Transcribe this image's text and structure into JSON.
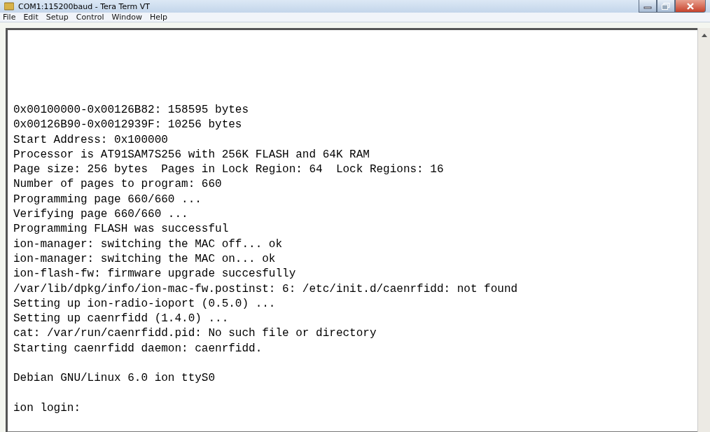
{
  "window": {
    "title": "COM1:115200baud - Tera Term VT"
  },
  "menu": [
    "File",
    "Edit",
    "Setup",
    "Control",
    "Window",
    "Help"
  ],
  "terminal": {
    "blocks": [
      [
        "0x00100000-0x00126B82: 158595 bytes",
        "0x00126B90-0x0012939F: 10256 bytes",
        "Start Address: 0x100000",
        "Processor is AT91SAM7S256 with 256K FLASH and 64K RAM",
        "Page size: 256 bytes  Pages in Lock Region: 64  Lock Regions: 16",
        "Number of pages to program: 660",
        "Programming page 660/660 ...",
        "Verifying page 660/660 ...",
        "Programming FLASH was successful",
        "ion-manager: switching the MAC off... ok",
        "ion-manager: switching the MAC on... ok",
        "ion-flash-fw: firmware upgrade succesfully",
        "/var/lib/dpkg/info/ion-mac-fw.postinst: 6: /etc/init.d/caenrfidd: not found",
        "Setting up ion-radio-ioport (0.5.0) ...",
        "Setting up caenrfidd (1.4.0) ...",
        "cat: /var/run/caenrfidd.pid: No such file or directory",
        "Starting caenrfidd daemon: caenrfidd."
      ],
      [
        "Debian GNU/Linux 6.0 ion ttyS0"
      ],
      [
        "ion login:"
      ]
    ]
  }
}
